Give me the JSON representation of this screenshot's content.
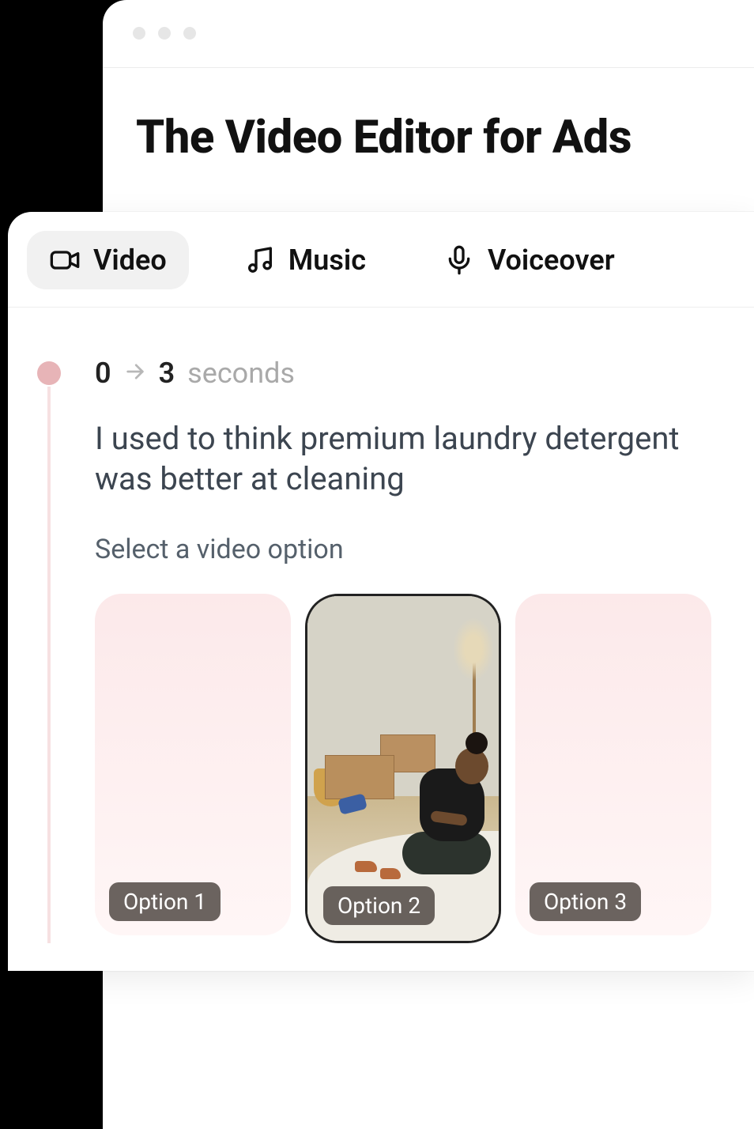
{
  "page_title": "The Video Editor for Ads",
  "tabs": [
    {
      "label": "Video",
      "active": true,
      "icon": "video-icon"
    },
    {
      "label": "Music",
      "active": false,
      "icon": "music-icon"
    },
    {
      "label": "Voiceover",
      "active": false,
      "icon": "mic-icon"
    }
  ],
  "segment": {
    "start": "0",
    "end": "3",
    "unit": "seconds",
    "script_text": "I used to think premium laundry detergent was better at cleaning",
    "prompt": "Select a video option"
  },
  "options": [
    {
      "label": "Option 1",
      "selected": false
    },
    {
      "label": "Option 2",
      "selected": true
    },
    {
      "label": "Option 3",
      "selected": false
    }
  ],
  "colors": {
    "timeline_dot": "#e7b4b7",
    "blank_card": "#fce9ea"
  }
}
